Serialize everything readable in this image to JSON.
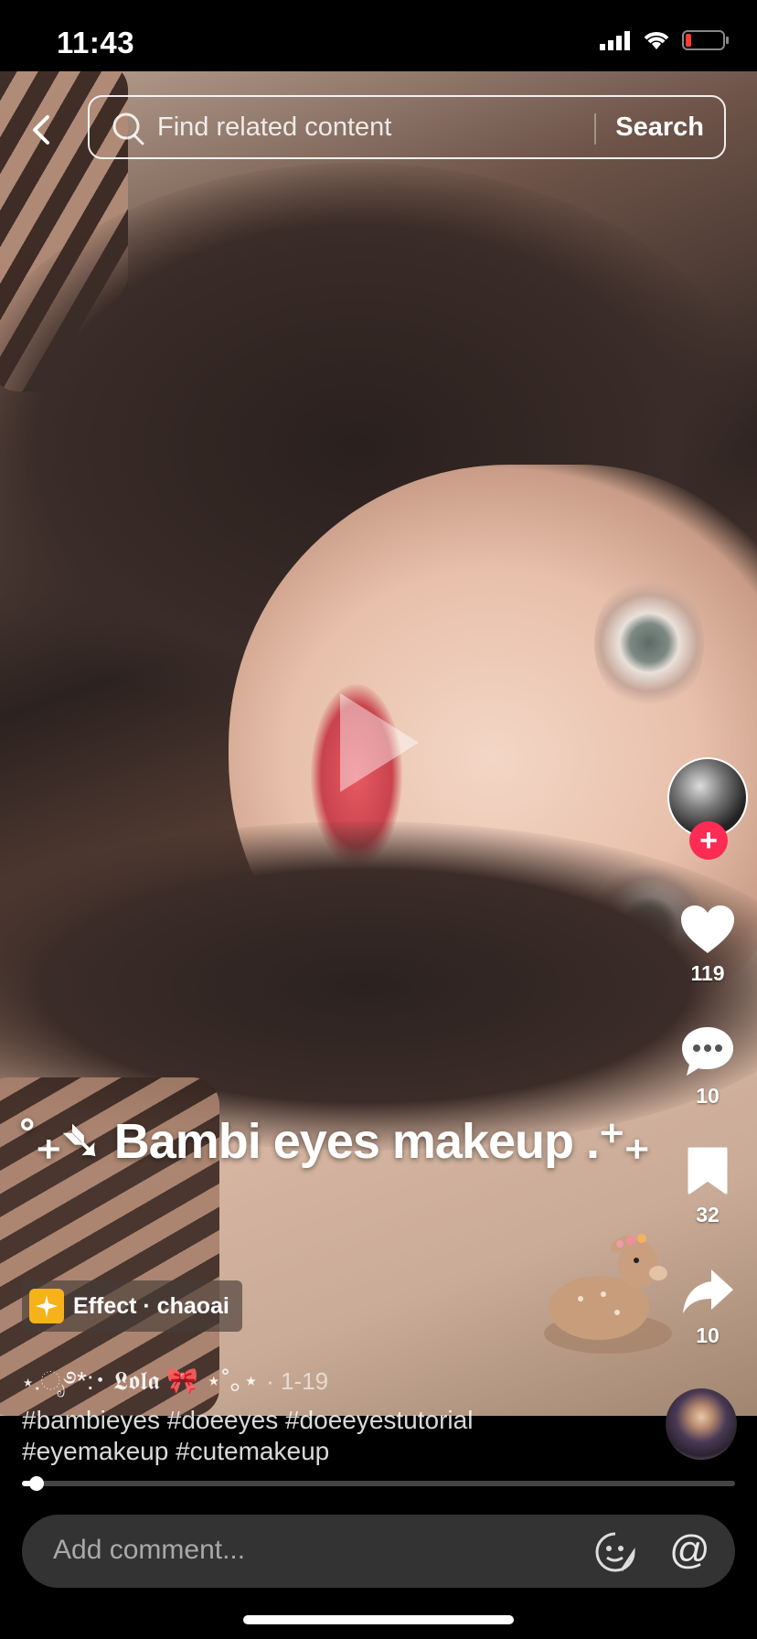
{
  "status_bar": {
    "time": "11:43"
  },
  "search": {
    "placeholder": "Find related content",
    "button_label": "Search"
  },
  "video": {
    "title_text": "˚₊➴ Bambi eyes makeup .⁺₊",
    "effect_label": "Effect · chaoai",
    "author": "⋆.ೃ࿔*:･ 𝕷𝖔𝖑𝖆 🎀 ⋆˚｡⋆",
    "date": "· 1-19",
    "hashtags": "#bambieyes #doeeyes #doeeyestutorial #eyemakeup #cutemakeup",
    "progress": 0.02
  },
  "actions": {
    "likes": "119",
    "comments": "10",
    "saves": "32",
    "shares": "10"
  },
  "comment_bar": {
    "placeholder": "Add comment..."
  },
  "colors": {
    "follow_accent": "#fe2c55",
    "effect_icon": "#f6b21b"
  },
  "icons": [
    "back-icon",
    "search-icon",
    "play-icon",
    "heart-icon",
    "comment-icon",
    "bookmark-icon",
    "share-icon",
    "emoji-icon",
    "at-icon"
  ]
}
